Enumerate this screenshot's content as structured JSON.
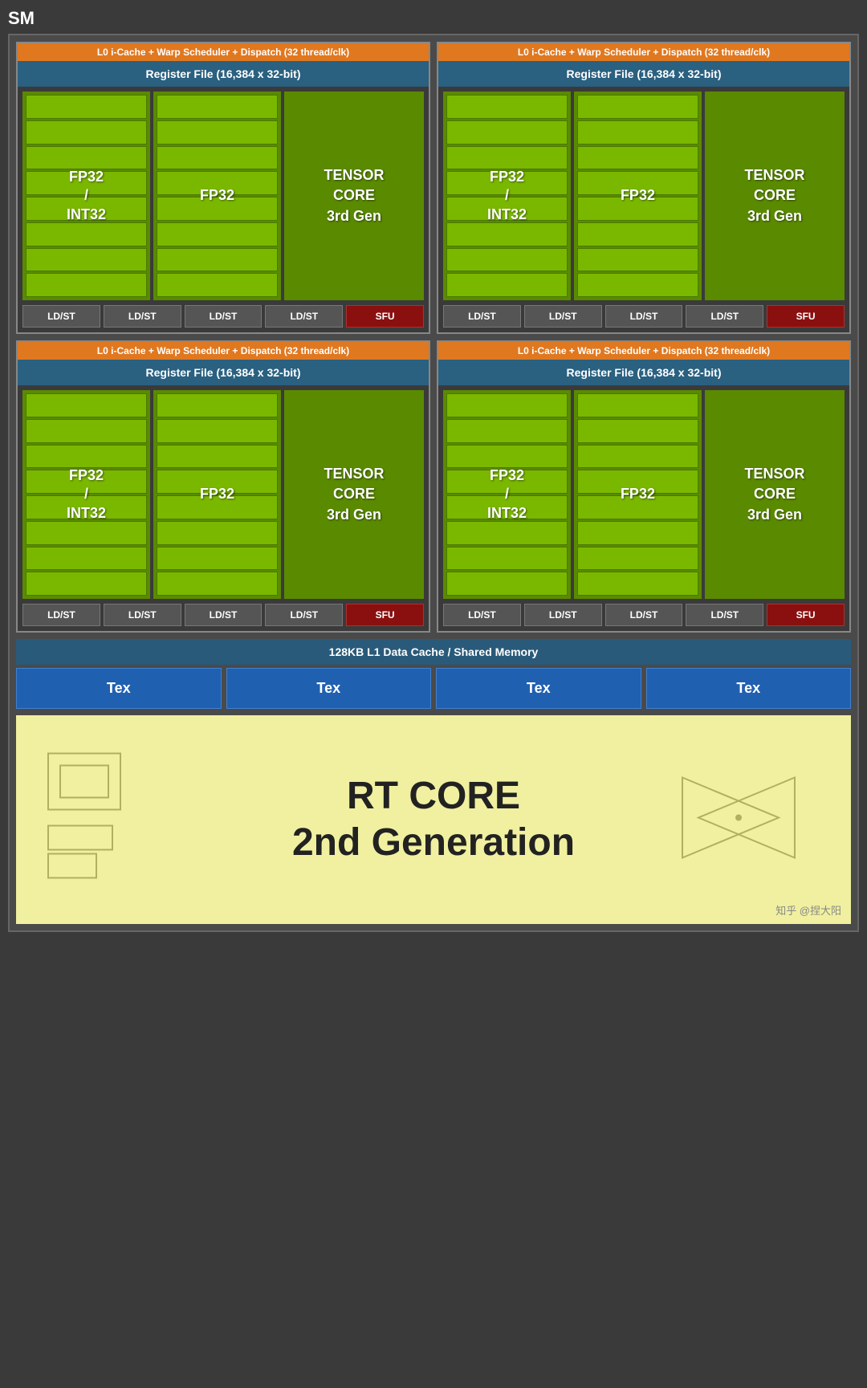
{
  "page": {
    "sm_label": "SM",
    "l0_bar_text": "L0 i-Cache + Warp Scheduler + Dispatch (32 thread/clk)",
    "reg_file_text": "Register File (16,384 x 32-bit)",
    "fp32_int32_label": "FP32\n/\nINT32",
    "fp32_label": "FP32",
    "tensor_label": "TENSOR\nCORE\n3rd Gen",
    "ldst_labels": [
      "LD/ST",
      "LD/ST",
      "LD/ST",
      "LD/ST"
    ],
    "sfu_label": "SFU",
    "shared_mem_label": "128KB L1 Data Cache / Shared Memory",
    "tex_labels": [
      "Tex",
      "Tex",
      "Tex",
      "Tex"
    ],
    "rt_core_line1": "RT CORE",
    "rt_core_line2": "2nd Generation",
    "watermark": "知乎 @捏大阳"
  }
}
